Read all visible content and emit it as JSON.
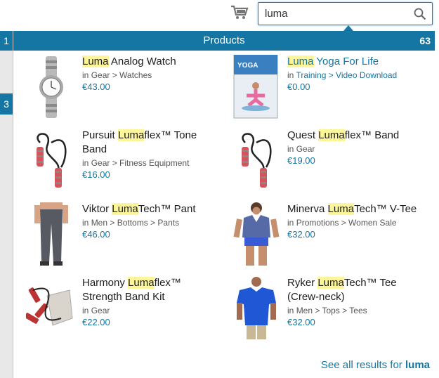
{
  "search": {
    "value": "luma"
  },
  "left_tabs": [
    "1",
    "3"
  ],
  "popup": {
    "title": "Products",
    "count": "63"
  },
  "products": [
    {
      "pre": "",
      "hl": "Luma",
      "post": " Analog Watch",
      "linked_name": false,
      "cat_prefix": "in ",
      "cat_path": "Gear > Watches",
      "cat_linked": false,
      "price": "€43.00",
      "thumb": "watch"
    },
    {
      "pre": "",
      "hl": "Luma",
      "post": " Yoga For Life",
      "linked_name": true,
      "cat_prefix": "in ",
      "cat_path": "Training > Video Download",
      "cat_linked": true,
      "price": "€0.00",
      "thumb": "dvd"
    },
    {
      "pre": "Pursuit ",
      "hl": "Luma",
      "post": "flex™ Tone Band",
      "linked_name": false,
      "cat_prefix": "in ",
      "cat_path": "Gear > Fitness Equipment",
      "cat_linked": false,
      "price": "€16.00",
      "thumb": "band"
    },
    {
      "pre": "Quest ",
      "hl": "Luma",
      "post": "flex™ Band",
      "linked_name": false,
      "cat_prefix": "in ",
      "cat_path": "Gear",
      "cat_linked": false,
      "price": "€19.00",
      "thumb": "band"
    },
    {
      "pre": "Viktor ",
      "hl": "Luma",
      "post": "Tech™ Pant",
      "linked_name": false,
      "cat_prefix": "in ",
      "cat_path": "Men > Bottoms > Pants",
      "cat_linked": false,
      "price": "€46.00",
      "thumb": "pant"
    },
    {
      "pre": "Minerva ",
      "hl": "Luma",
      "post": "Tech™ V-Tee",
      "linked_name": false,
      "cat_prefix": "in ",
      "cat_path": "Promotions > Women Sale",
      "cat_linked": false,
      "price": "€32.00",
      "thumb": "vtee"
    },
    {
      "pre": "Harmony ",
      "hl": "Luma",
      "post": "flex™ Strength Band Kit",
      "linked_name": false,
      "cat_prefix": "in ",
      "cat_path": "Gear",
      "cat_linked": false,
      "price": "€22.00",
      "thumb": "kit"
    },
    {
      "pre": "Ryker ",
      "hl": "Luma",
      "post": "Tech™ Tee (Crew-neck)",
      "linked_name": false,
      "cat_prefix": "in ",
      "cat_path": "Men > Tops > Tees",
      "cat_linked": false,
      "price": "€32.00",
      "thumb": "tee"
    }
  ],
  "see_all": {
    "text": "See all results for ",
    "term": "luma"
  },
  "colors": {
    "accent": "#1576a4",
    "highlight": "#fdf59a"
  },
  "icons": {
    "cart": "shopping-cart-icon",
    "search": "search-icon"
  }
}
